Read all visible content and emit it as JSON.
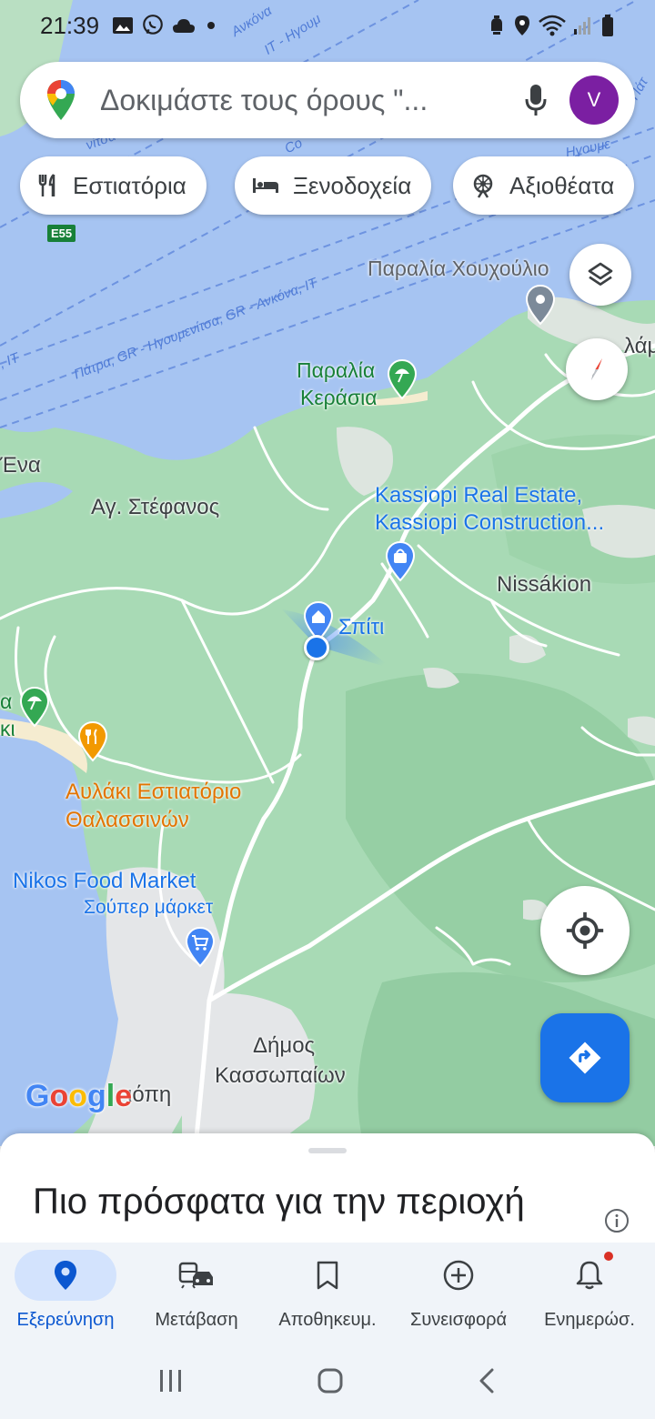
{
  "status_bar": {
    "time": "21:39",
    "icons": [
      "gallery-icon",
      "viber-icon",
      "cloud-icon",
      "dot-icon",
      "alarm-icon",
      "location-icon",
      "wifi-icon",
      "signal-icon",
      "battery-icon"
    ]
  },
  "search": {
    "placeholder": "Δοκιμάστε τους όρους \"...",
    "avatar_letter": "V",
    "accent": "#7b1fa2"
  },
  "chips": [
    {
      "label": "Εστιατόρια",
      "icon": "restaurant-icon"
    },
    {
      "label": "Ξενοδοχεία",
      "icon": "hotel-icon"
    },
    {
      "label": "Αξιοθέατα",
      "icon": "attraction-icon"
    }
  ],
  "map": {
    "road_shield": "E55",
    "ferry_routes": [
      "Πάτρα, GR - Ηγουμενίτσα, GR - Ανκόνα, IT",
      ", IT",
      "IT - Ηγουμ",
      "Ανκόνα",
      "Πάτ",
      "Ηγουμε",
      "Co",
      "νίτσα"
    ],
    "labels": {
      "beach_houxoulio": "Παραλία Χουχούλιο",
      "beach_kerasia_1": "Παραλία",
      "beach_kerasia_2": "Κεράσια",
      "ena": "Ένα",
      "ag_stefanos": "Αγ. Στέφανος",
      "kassiopi_1": "Kassiopi Real Estate,",
      "kassiopi_2": "Kassiopi Construction...",
      "nissakion": "Nissákion",
      "home": "Σπίτι",
      "avlaki_1": "Αυλάκι Εστιατόριο",
      "avlaki_2": "Θαλασσινών",
      "nikos_1": "Nikos Food Market",
      "nikos_2": "Σούπερ μάρκετ",
      "dimos_1": "Δήμος",
      "dimos_2": "Κασσωπαίων",
      "kassiopi_town": "ιόπη",
      "lam": "λάμ",
      "edge_a": "α",
      "edge_ki": "κι",
      "google": "Google"
    }
  },
  "sheet": {
    "title": "Πιο πρόσφατα για την περιοχή"
  },
  "nav": [
    {
      "label": "Εξερεύνηση",
      "icon": "explore-pin-icon",
      "active": true
    },
    {
      "label": "Μετάβαση",
      "icon": "commute-icon",
      "active": false
    },
    {
      "label": "Αποθηκευμ.",
      "icon": "bookmark-icon",
      "active": false
    },
    {
      "label": "Συνεισφορά",
      "icon": "add-circle-icon",
      "active": false
    },
    {
      "label": "Ενημερώσ.",
      "icon": "bell-icon",
      "active": false
    }
  ],
  "colors": {
    "water": "#a6c4f2",
    "land": "#a8dab5",
    "primary_blue": "#1a73e8",
    "green_label": "#188038",
    "orange_label": "#e37400"
  }
}
